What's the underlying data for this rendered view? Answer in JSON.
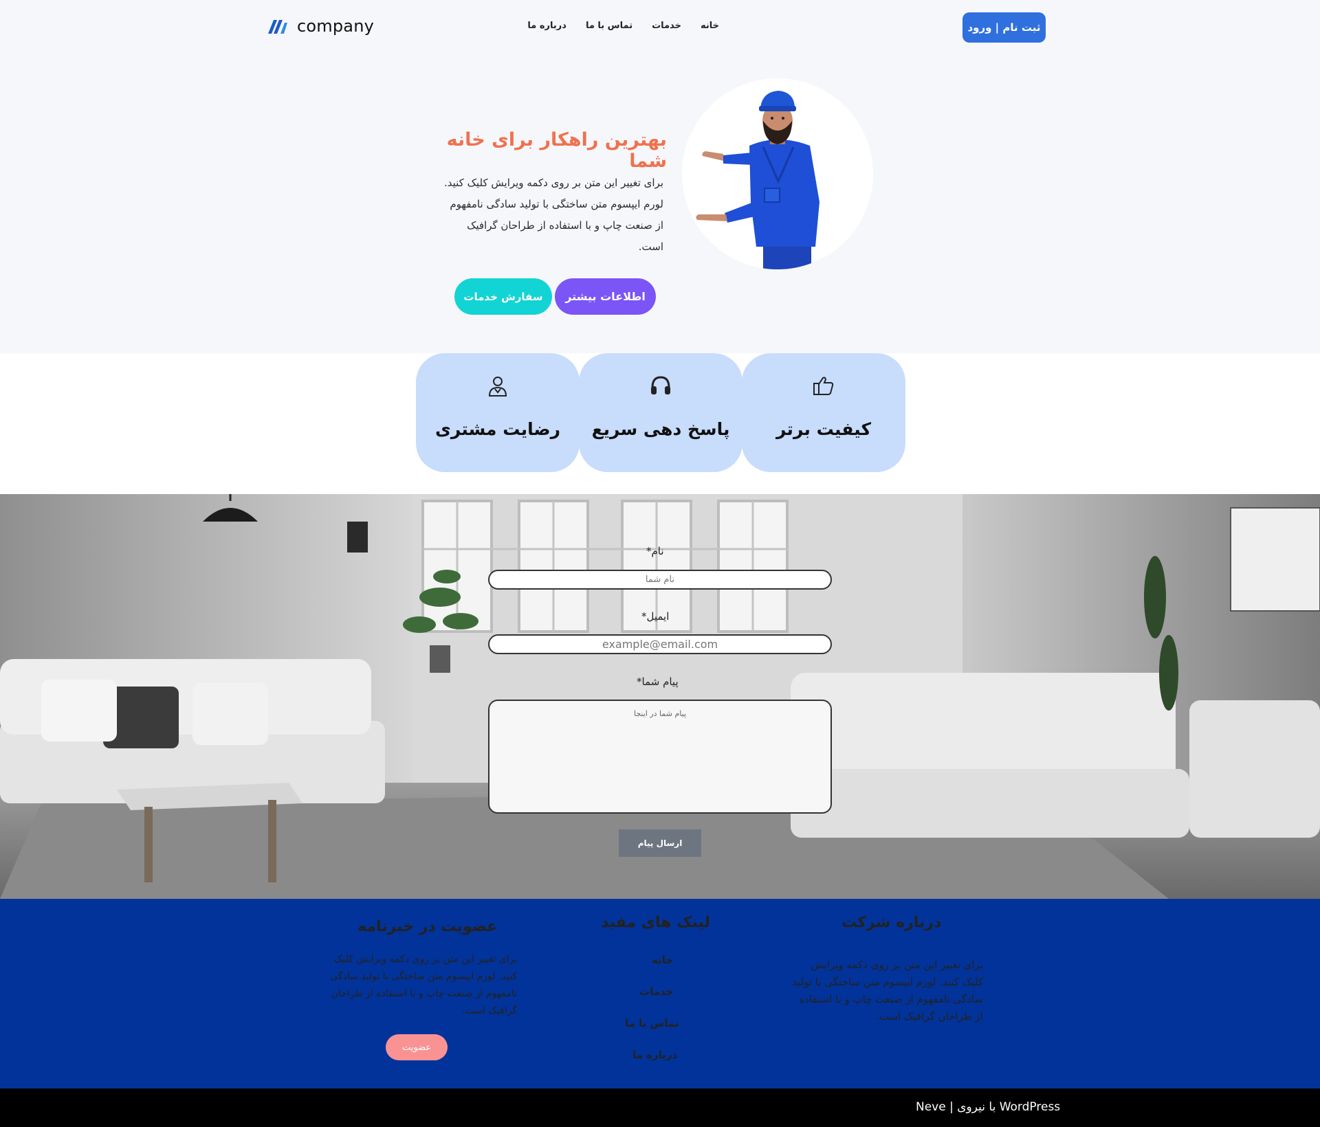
{
  "header": {
    "logo_text": "company",
    "nav": [
      {
        "label": "خانه"
      },
      {
        "label": "خدمات"
      },
      {
        "label": "تماس با ما"
      },
      {
        "label": "درباره ما"
      }
    ],
    "auth_label": "ثبت نام | ورود"
  },
  "hero": {
    "title": "بهترین راهکار برای خانه شما",
    "text": "برای تغییر این متن بر روی دکمه ویرایش کلیک کنید. لورم ایپسوم متن ساختگی با تولید سادگی نامفهوم از صنعت چاپ و با استفاده از طراحان گرافیک است.",
    "btn_more": "اطلاعات بیشتر",
    "btn_order": "سفارش خدمات"
  },
  "features": [
    {
      "label": "کیفیت برتر",
      "icon": "thumbs-up-icon"
    },
    {
      "label": "پاسخ دهی سریع",
      "icon": "headset-icon"
    },
    {
      "label": "رضایت مشتری",
      "icon": "user-icon"
    }
  ],
  "contact": {
    "name_label": "نام*",
    "name_placeholder": "نام شما",
    "email_label": "ایمیل*",
    "email_placeholder": "example@email.com",
    "message_label": "پیام شما*",
    "message_placeholder": "پیام شما در اینجا",
    "submit_label": "ارسال پیام"
  },
  "footer": {
    "about": {
      "title": "درباره شرکت",
      "text": "برای تغییر این متن بر روی دکمه ویرایش کلیک کنید. لورم ایپسوم متن ساختگی با تولید سادگی نامفهوم از صنعت چاپ و با استفاده از طراحان گرافیک است."
    },
    "links": {
      "title": "لینک های مفید",
      "items": [
        {
          "label": "خانه"
        },
        {
          "label": "خدمات"
        },
        {
          "label": "تماس با ما"
        },
        {
          "label": "درباره ما"
        }
      ]
    },
    "newsletter": {
      "title": "عضویت در خبرنامه",
      "text": "برای تغییر این متن بر روی دکمه ویرایش کلیک کنید. لورم ایپسوم متن ساختگی با تولید سادگی نامفهوم از صنعت چاپ و با استفاده از طراحان گرافیک است.",
      "button": "عضویت"
    },
    "credit": "Neve | با نیروی WordPress"
  },
  "colors": {
    "brand": "#2f6fde",
    "hero_title": "#f0714f",
    "more_button": "#7b55f5",
    "order_button": "#12d4d4",
    "card_bg": "#c8dcfc",
    "footer_bg": "#02339a",
    "join_button": "#f99393"
  }
}
